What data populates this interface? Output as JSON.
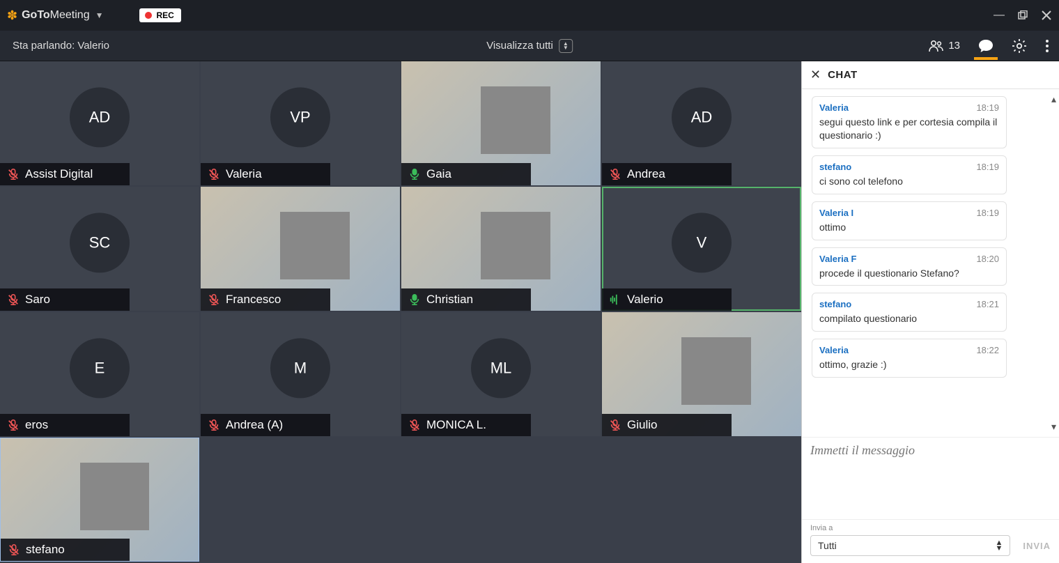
{
  "titlebar": {
    "brand_bold": "GoTo",
    "brand_light": "Meeting",
    "rec_label": "REC"
  },
  "toolbar": {
    "speaking_prefix": "Sta parlando: ",
    "speaking_name": "Valerio",
    "view_label": "Visualizza tutti",
    "participant_count": "13"
  },
  "tiles": [
    {
      "name": "Assist Digital",
      "initials": "AD",
      "mic": "muted",
      "video": false
    },
    {
      "name": "Valeria",
      "initials": "VP",
      "mic": "muted",
      "video": false
    },
    {
      "name": "Gaia",
      "initials": "",
      "mic": "on",
      "video": true
    },
    {
      "name": "Andrea",
      "initials": "AD",
      "mic": "muted",
      "video": false
    },
    {
      "name": "Saro",
      "initials": "SC",
      "mic": "muted",
      "video": false
    },
    {
      "name": "Francesco",
      "initials": "",
      "mic": "muted",
      "video": true
    },
    {
      "name": "Christian",
      "initials": "",
      "mic": "on",
      "video": true
    },
    {
      "name": "Valerio",
      "initials": "V",
      "mic": "speaking",
      "video": false
    },
    {
      "name": "eros",
      "initials": "E",
      "mic": "muted",
      "video": false
    },
    {
      "name": "Andrea (A)",
      "initials": "M",
      "mic": "muted",
      "video": false
    },
    {
      "name": "MONICA L.",
      "initials": "ML",
      "mic": "muted",
      "video": false
    },
    {
      "name": "Giulio",
      "initials": "",
      "mic": "muted",
      "video": true
    },
    {
      "name": "stefano",
      "initials": "",
      "mic": "muted",
      "video": true
    }
  ],
  "chat": {
    "title": "CHAT",
    "messages": [
      {
        "sender": "Valeria",
        "time": "18:19",
        "body": "segui questo link e per cortesia compila il questionario :)"
      },
      {
        "sender": "stefano",
        "time": "18:19",
        "body": "ci sono col telefono"
      },
      {
        "sender": "Valeria I",
        "time": "18:19",
        "body": "ottimo"
      },
      {
        "sender": "Valeria F",
        "time": "18:20",
        "body": "procede il questionario Stefano?"
      },
      {
        "sender": "stefano",
        "time": "18:21",
        "body": "compilato questionario"
      },
      {
        "sender": "Valeria",
        "time": "18:22",
        "body": "ottimo, grazie :)"
      }
    ],
    "input_placeholder": "Immetti il messaggio",
    "send_to_label": "Invia a",
    "send_to_value": "Tutti",
    "send_button": "INVIA"
  }
}
